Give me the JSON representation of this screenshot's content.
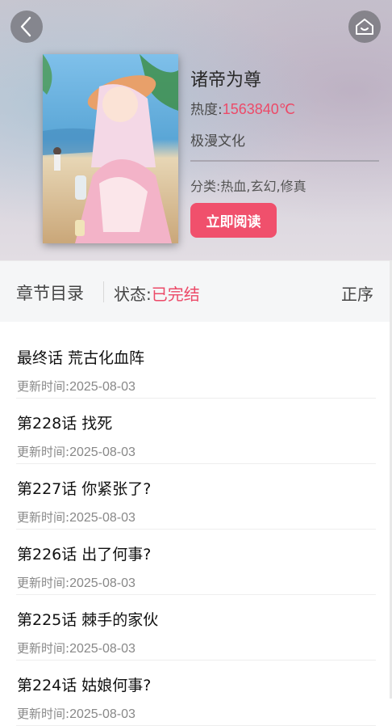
{
  "nav": {
    "back_icon": "chevron-left-icon",
    "home_icon": "home-icon"
  },
  "comic": {
    "title": "诸帝为尊",
    "heat_label": "热度:",
    "heat_value": "1563840℃",
    "publisher": "极漫文化",
    "genre": "分类:热血,玄幻,修真",
    "read_button": "立即阅读"
  },
  "catalog": {
    "title": "章节目录",
    "status_label": "状态:",
    "status_value": "已完结",
    "sort_label": "正序",
    "update_label": "更新时间:",
    "chapters": [
      {
        "name": "最终话 荒古化血阵",
        "date": "2025-08-03"
      },
      {
        "name": "第228话 找死",
        "date": "2025-08-03"
      },
      {
        "name": "第227话 你紧张了?",
        "date": "2025-08-03"
      },
      {
        "name": "第226话 出了何事?",
        "date": "2025-08-03"
      },
      {
        "name": "第225话 棘手的家伙",
        "date": "2025-08-03"
      },
      {
        "name": "第224话 姑娘何事?",
        "date": "2025-08-03"
      }
    ]
  },
  "colors": {
    "accent": "#f0506c",
    "status": "#ec4a68"
  }
}
